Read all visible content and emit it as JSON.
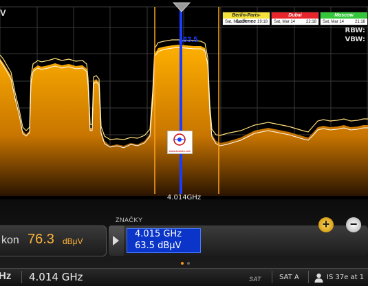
{
  "spectrum": {
    "unit_fragment": "V",
    "center_freq": "4.014GHz",
    "marker_label": "63.5",
    "rbw_label": "RBW:",
    "vbw_label": "VBW:",
    "trace_color": "#ffd21e",
    "fill_color": "#ffa500",
    "marker_color": "#1a3cff",
    "band_line_color": "#ffa41a"
  },
  "clocks": [
    {
      "city": "Berlin-Paris-Lučenec",
      "date": "Sat, Mar 14",
      "time": "19:18",
      "color": "#f5e23a"
    },
    {
      "city": "Dubai",
      "date": "Sat, Mar 14",
      "time": "22:18",
      "color": "#e8252a"
    },
    {
      "city": "Moscow",
      "date": "Sat, Mar 14",
      "time": "21:18",
      "color": "#35c73a"
    }
  ],
  "power": {
    "label": "kon",
    "value": "76.3",
    "unit": "dBμV"
  },
  "markers": {
    "title": "ZNAČKY",
    "freq": "4.015 GHz",
    "level": "63.5 dBμV"
  },
  "buttons": {
    "plus": "+",
    "minus": "−"
  },
  "status": {
    "ghz_fragment": "Hz",
    "frequency": "4.014 GHz",
    "sat_logo": "SAT",
    "sat_input": "SAT A",
    "satellite": "IS 37e at 1"
  },
  "watermark": {
    "text": "www.dxsatcs.com"
  }
}
